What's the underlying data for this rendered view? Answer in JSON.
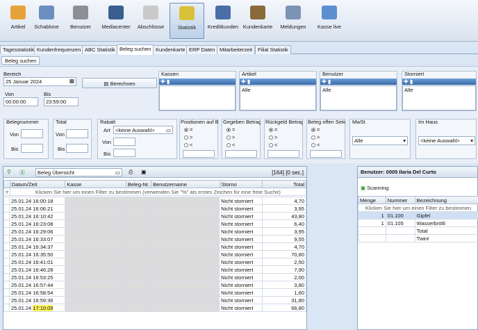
{
  "toolbar": {
    "items": [
      {
        "label": "Artikel",
        "icon": "coins-icon"
      },
      {
        "label": "Schablone",
        "icon": "template-icon"
      },
      {
        "label": "Benutzer",
        "icon": "users-icon"
      },
      {
        "label": "Mediacenter",
        "icon": "monitor-icon"
      },
      {
        "label": "Abschlüsse",
        "icon": "document-icon"
      },
      {
        "label": "Statistik",
        "icon": "chart-icon"
      },
      {
        "label": "Kreditkunden",
        "icon": "customer-icon"
      },
      {
        "label": "Kundenkarte",
        "icon": "card-icon"
      },
      {
        "label": "Meldungen",
        "icon": "message-icon"
      },
      {
        "label": "Kasse live",
        "icon": "register-icon"
      }
    ]
  },
  "tabs": [
    "Tagesstatistik",
    "Kundenfrequenzen",
    "ABC Statistik",
    "Beleg suchen",
    "Kundenkarte",
    "ERP Daten",
    "Mitarbeiterzeit",
    "Filial Statistik"
  ],
  "subtab": "Beleg suchen",
  "filters": {
    "bereich_label": "Bereich",
    "date": "25 Januar 2024",
    "berechnen": "Berechnen",
    "von_label": "Von",
    "von": "00:00:00",
    "bis_label": "Bis",
    "bis": "23:59:00",
    "kassen": "Kassen",
    "artikel": "Artikel",
    "artikel_val": "Alle",
    "benutzer": "Benutzer",
    "benutzer_val": "Alle",
    "storniert": "Storniert",
    "storniert_val": "Alle",
    "belegnummer": "Belegnummer",
    "von2": "Von",
    "bis2": "Bis",
    "total": "Total",
    "von3": "Von",
    "bis3": "Bis",
    "rabatt": "Rabatt",
    "art": "Art",
    "art_val": "<keine Auswahl>",
    "von4": "Von",
    "bis4": "Bis",
    "positionen": "Positionen auf Bel",
    "gegeben": "Gegeben Betrag",
    "rueckgeld": "Rückgeld Betrag",
    "offen": "Beleg offen Sekund",
    "mwst": "MwSt",
    "mwst_val": "Alle",
    "imhaus": "Im Haus",
    "imhaus_val": "<keine Auswahl>",
    "eq": "=",
    "gt": ">",
    "lt": "<"
  },
  "grid": {
    "view": "Beleg Übersicht",
    "count": "[164] [0 sec.]",
    "columns": [
      "Datum/Zeit",
      "Kasse",
      "Beleg-Nr.",
      "Benutzername",
      "Storno",
      "Total"
    ],
    "hint": "Klicken Sie hier um einen Filter zu bestimmen (verwenden Sie \"%\" als erstes Zeichen für eine freie Suche)",
    "rows": [
      {
        "dt": "25.01.24 16:00:18",
        "storno": "Nicht storniert",
        "total": "4,70"
      },
      {
        "dt": "25.01.24 16:06:21",
        "storno": "Nicht storniert",
        "total": "3,95"
      },
      {
        "dt": "25.01.24 16:10:42",
        "storno": "Nicht storniert",
        "total": "43,80"
      },
      {
        "dt": "25.01.24 16:23:08",
        "storno": "Nicht storniert",
        "total": "6,40"
      },
      {
        "dt": "25.01.24 16:29:06",
        "storno": "Nicht storniert",
        "total": "3,95"
      },
      {
        "dt": "25.01.24 16:33:07",
        "storno": "Nicht storniert",
        "total": "9,55"
      },
      {
        "dt": "25.01.24 16:34:37",
        "storno": "Nicht storniert",
        "total": "4,70"
      },
      {
        "dt": "25.01.24 16:35:50",
        "storno": "Nicht storniert",
        "total": "70,80"
      },
      {
        "dt": "25.01.24 16:41:01",
        "storno": "Nicht storniert",
        "total": "2,50"
      },
      {
        "dt": "25.01.24 16:46:28",
        "storno": "Nicht storniert",
        "total": "7,90"
      },
      {
        "dt": "25.01.24 16:53:25",
        "storno": "Nicht storniert",
        "total": "2,00"
      },
      {
        "dt": "25.01.24 16:57:44",
        "storno": "Nicht storniert",
        "total": "3,80"
      },
      {
        "dt": "25.01.24 16:58:54",
        "storno": "Nicht storniert",
        "total": "1,60"
      },
      {
        "dt": "25.01.24 16:59:36",
        "storno": "Nicht storniert",
        "total": "31,80"
      },
      {
        "dt_date": "25.01.24",
        "dt_time": "17:10:09",
        "storno": "Nicht storniert",
        "total": "66,80"
      }
    ]
  },
  "detail": {
    "title": "Benutzer: 0005 Ilaria Del Curto",
    "scanning": "Scanning",
    "columns": [
      "Menge",
      "Nummer",
      "Bezeichnung"
    ],
    "hint": "Klicken Sie hier um einen Filter zu bestimmen",
    "rows": [
      {
        "menge": "1",
        "nummer": "01.100",
        "bez": "Gipfel"
      },
      {
        "menge": "1",
        "nummer": "01.105",
        "bez": "Wasserbrötli"
      },
      {
        "menge": "",
        "nummer": "",
        "bez": "Total"
      },
      {
        "menge": "",
        "nummer": "",
        "bez": "Twint"
      }
    ]
  },
  "colors": {
    "accent": "#3f72b3",
    "highlight": "#fff45a"
  }
}
